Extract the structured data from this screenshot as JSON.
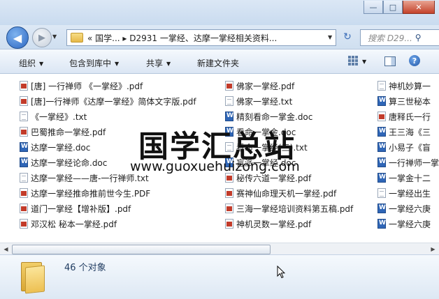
{
  "window": {
    "minimize": "—",
    "maximize": "□",
    "close": "✕"
  },
  "address": {
    "path": "« 国学... ▸ D2931 一掌经、达摩一掌经相关资料...",
    "search_placeholder": "搜索 D29..."
  },
  "toolbar": {
    "organize": "组织",
    "include_library": "包含到库中",
    "share": "共享",
    "new_folder": "新建文件夹"
  },
  "columns": [
    [
      {
        "name": "[唐] 一行禅师 《一掌经》.pdf",
        "type": "pdf"
      },
      {
        "name": "[唐]一行禅师《达摩一掌经》简体文字版.pdf",
        "type": "pdf"
      },
      {
        "name": "《一掌经》.txt",
        "type": "txt"
      },
      {
        "name": "巴蜀推命一掌经.pdf",
        "type": "pdf"
      },
      {
        "name": "达摩一掌经.doc",
        "type": "doc"
      },
      {
        "name": "达摩一掌经论命.doc",
        "type": "doc"
      },
      {
        "name": "达摩一掌经——唐-一行禅师.txt",
        "type": "txt"
      },
      {
        "name": "达摩一掌经推命推前世今生.PDF",
        "type": "pdf"
      },
      {
        "name": "道门一掌经【增补版】.pdf",
        "type": "pdf"
      },
      {
        "name": "邓汉松 秘本一掌经.pdf",
        "type": "pdf"
      }
    ],
    [
      {
        "name": "佛家一掌经.pdf",
        "type": "pdf"
      },
      {
        "name": "佛家一掌经.txt",
        "type": "txt"
      },
      {
        "name": "精刻看命一掌金.doc",
        "type": "doc"
      },
      {
        "name": "看命一掌金.doc",
        "type": "doc"
      },
      {
        "name": "看命一掌经(三).txt",
        "type": "txt"
      },
      {
        "name": "盲派一掌经.doc",
        "type": "doc"
      },
      {
        "name": "秘传六道一掌经.pdf",
        "type": "pdf"
      },
      {
        "name": "赛神仙命理天机一掌经.pdf",
        "type": "pdf"
      },
      {
        "name": "三海一掌经培训资料第五稿.pdf",
        "type": "pdf"
      },
      {
        "name": "神机灵数一掌经.pdf",
        "type": "pdf"
      }
    ],
    [
      {
        "name": "神机妙算一",
        "type": "txt"
      },
      {
        "name": "算三世秘本",
        "type": "doc"
      },
      {
        "name": "唐释氏一行",
        "type": "pdf"
      },
      {
        "name": "王三海《三",
        "type": "doc"
      },
      {
        "name": "小易子《盲",
        "type": "doc"
      },
      {
        "name": "一行禅师一掌",
        "type": "doc"
      },
      {
        "name": "一掌金十二",
        "type": "doc"
      },
      {
        "name": "一掌经出生",
        "type": "txt"
      },
      {
        "name": "一掌经六庚",
        "type": "doc"
      },
      {
        "name": "一掌经六庚",
        "type": "doc"
      }
    ]
  ],
  "status": {
    "count": "46 个对象"
  },
  "watermark": {
    "title": "国学汇总站",
    "url": "www.guoxuehuizong.com"
  }
}
